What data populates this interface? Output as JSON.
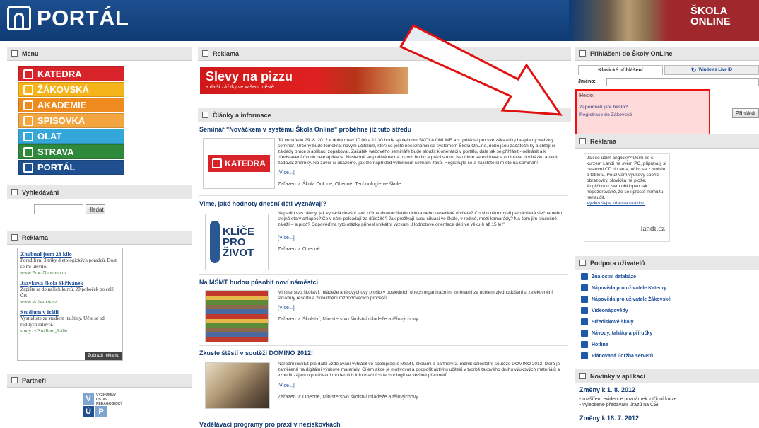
{
  "header": {
    "logo_text": "PORTÁL",
    "school_line1": "ŠKOLA",
    "school_line2": "ONLINE"
  },
  "menu": {
    "title": "Menu",
    "items": [
      {
        "label": "KATEDRA",
        "color": "#d9232a"
      },
      {
        "label": "ŽÁKOVSKÁ",
        "color": "#f4b41a"
      },
      {
        "label": "AKADEMIE",
        "color": "#ef8a1e"
      },
      {
        "label": "SPISOVKA",
        "color": "#f3a640"
      },
      {
        "label": "OLAT",
        "color": "#35a6d8"
      },
      {
        "label": "STRAVA",
        "color": "#2e8a3a"
      },
      {
        "label": "PORTÁL",
        "color": "#1f4f8f"
      }
    ]
  },
  "search": {
    "title": "Vyhledávání",
    "button": "Hledat"
  },
  "left_ads": {
    "title": "Reklama",
    "items": [
      {
        "link": "Zhubnul jsem 28 kilo",
        "text": "Poradili mi 3 triky dietologických poradců. Dost se mi ulevilo.",
        "url": "www.Proc-Nehubnu.cz"
      },
      {
        "link": "Jazyková škola Skřivánek",
        "text": "Zapište se do našich kurzů. 20 poboček po celé ČR!",
        "url": "www.skrivanek.cz"
      },
      {
        "link": "Studium v Itálii",
        "text": "Vystudujte za studiem italštiny. Učte se od rodilých mluvčí.",
        "url": "study.cz/Studium_Italie"
      }
    ],
    "footer": "Zobrazit reklamu"
  },
  "partners": {
    "title": "Partneři",
    "name": "VÝZKUMNÝ ÚSTAV PEDAGOGICKÝ",
    "letters": [
      "V",
      "Ú",
      "P"
    ]
  },
  "middle_ad": {
    "title": "Reklama",
    "headline": "Slevy na pizzu",
    "subline": "a další zážitky ve vašem městě"
  },
  "articles": {
    "title": "Články a informace",
    "items": [
      {
        "title": "Seminář \"Nováčkem v systému Škola Online\" proběhne již tuto středu",
        "text": "Již ve středu 29. 8. 2012 v době mezi 10.00 a 11.30 bude společnost ŠKOLA ONLINE a.s. pořádat pro své zákazníky bezplatný webový seminář. Určený bude tentokrát novým učitelům, kteří se ještě neseznámili se systémem Škola OnLine, nebo jsou začátečníky a chtějí si základy práce s aplikací zopakovat. Začátek webového semináře bude sloužit k orientaci v portálu, dále jak se přihlásit - odhlásit a k představení úvodu celé aplikace. Následně se podíváme na rozvrh hodin a práci s ním. Naučíme se evidovat a omlouvat docházku a také zadávat známky. Na závěr si ukážeme, jak lze například vytisknout seznam žáků. Registrujte se a zajistěte si místo na semináři!",
        "more": "[Více...]",
        "meta": "Zařazen v: Škola OnLine, Obecné, Technologie ve škole",
        "image_label": "KATEDRA"
      },
      {
        "title": "Víme, jaké hodnoty dnešní děti vyznávají?",
        "text": "Napadlo vás někdy, jak vypadá dnešní svět očima dvanáctiletého kluka nebo desetileté dívčete? Co si o něm myslí patnáctiletá slečna nebo stejně starý chlapec? Co v něm pokládají za důležité? Jak prožívají svou situaci ve škole, v rodině, mezi kamarády? Na čem jim skutečně záleží – a proč? Odpověď na tyto otázky přinesl unikátní výzkum „Hodnotové orientace dětí ve věku 6 až 15 let\".",
        "more": "[Více...]",
        "meta": "Zařazen v: Obecné",
        "image_lines": [
          "KLÍČE",
          "PRO",
          "ŽIVOT"
        ]
      },
      {
        "title": "Na MŠMT budou působit noví náměstci",
        "text": "Ministerstvo školství, mládeže a tělovýchovy prošlo v posledních dnech organizačními změnami za účelem zjednodušení a zefektivnění struktury resortu a zkvalitnění rozhodovacích procesů.",
        "more": "[Více...]",
        "meta": "Zařazen v: Školství, Ministerstvo školství mládeže a tělovýchovy"
      },
      {
        "title": "Zkuste štěstí v soutěži DOMINO 2012!",
        "text": "Národní institut pro další vzdělávání vyhlásil ve spolupráci s MŠMT, školami a partnery 2. ročník celostátní soutěže DOMINO 2012, která je zaměřená na digitální výukové materiály. Cílem akce je motivovat a podpořit aktivitu učitelů v tvorbě takového druhu výukových materiálů a vzbudit zájem o používání moderních informačních technologií ve většině předmětů.",
        "more": "[Více...]",
        "meta": "Zařazen v: Obecné, Ministerstvo školství mládeže a tělovýchovy"
      },
      {
        "title": "Vzdělávací programy pro praxi v neziskovkách"
      }
    ]
  },
  "login": {
    "title": "Přihlášení do Školy OnLine",
    "tab_classic": "Klasické přihlášení",
    "tab_live": "Windows Live ID",
    "name_label": "Jméno:",
    "password_label": "Heslo:",
    "forgot": "Zapomněli jste heslo?",
    "register": "Registrace do Žákovské",
    "button": "Přihlásit"
  },
  "right_ad": {
    "title": "Reklama",
    "text": "Jak se učím anglicky? Učím se s kurzem Landi na svém PC, připravuji si cestovní CD do auta, učím se z mobilu a tabletu. Používám výukový spořič obrazovky, slovíčka na ploše. Angličtinou jsem obklopen tak nepozorovaně, že se i prostě nemůžu nenaučit.",
    "link": "Vyzkoušejte zdarma ukázku.",
    "brand": "landi.cz"
  },
  "support": {
    "title": "Podpora uživatelů",
    "items": [
      "Znalostní databáze",
      "Nápověda pro uživatele Katedry",
      "Nápověda pro uživatele Žákovské",
      "Videonápovědy",
      "Střediskové školy",
      "Návody, taháky a příručky",
      "Hotline",
      "Plánovaná údržba serverů"
    ]
  },
  "news": {
    "title": "Novinky v aplikaci",
    "items": [
      {
        "date": "Změny k 1. 8. 2012",
        "lines": [
          "- rozšíření evidence poznámek v třídní knize",
          "- vylepšené předávání úrazů na ČŠI"
        ]
      },
      {
        "date": "Změny k 18. 7. 2012"
      }
    ]
  },
  "colors": {
    "header_blue": "#0f3b74",
    "link": "#1a4b96",
    "annotation": "#e11111"
  }
}
